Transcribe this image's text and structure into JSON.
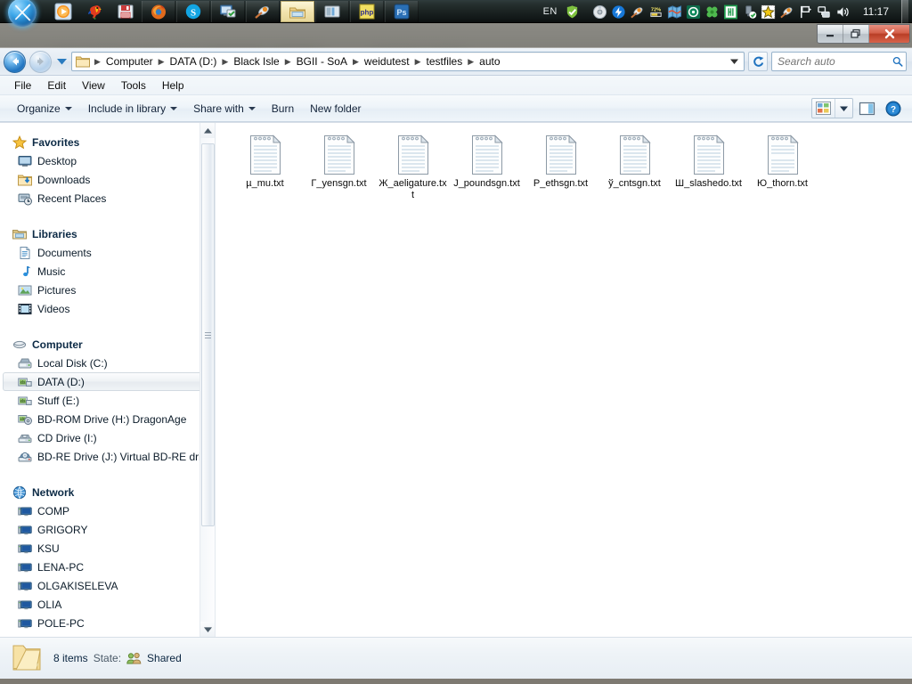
{
  "taskbar": {
    "start_button": "Start",
    "pinned_items": [
      {
        "name": "media-player-icon",
        "label": "Media Player"
      },
      {
        "name": "parrot-icon",
        "label": "Parrot"
      },
      {
        "name": "floppy-save-icon",
        "label": "Save"
      },
      {
        "name": "firefox-icon",
        "label": "Firefox"
      },
      {
        "name": "skype-icon",
        "label": "Skype"
      },
      {
        "name": "remote-desktop-icon",
        "label": "Remote Desktop"
      },
      {
        "name": "comet-icon",
        "label": "Comet"
      },
      {
        "name": "explorer-icon",
        "label": "Windows Explorer"
      },
      {
        "name": "presentation-icon",
        "label": "Presentation"
      },
      {
        "name": "php-icon",
        "label": "PHP"
      },
      {
        "name": "photoshop-icon",
        "label": "Ps"
      }
    ],
    "language": "EN",
    "tray_icons": [
      {
        "name": "shield-check-icon",
        "label": "Security"
      },
      {
        "name": "disc-icon",
        "label": "Disc"
      },
      {
        "name": "flash-icon",
        "label": "Flash"
      },
      {
        "name": "comet-tray-icon",
        "label": "Comet"
      },
      {
        "name": "battery-icon",
        "label": "72%"
      },
      {
        "name": "map-icon",
        "label": "Map"
      },
      {
        "name": "green-circle-icon",
        "label": "Opera"
      },
      {
        "name": "clover-icon",
        "label": "Clover"
      },
      {
        "name": "notepad-green-icon",
        "label": "Notepad"
      },
      {
        "name": "usb-check-icon",
        "label": "Safely Remove Hardware"
      },
      {
        "name": "yellow-burst-icon",
        "label": "Update"
      },
      {
        "name": "comet2-icon",
        "label": "Comet"
      },
      {
        "name": "flag-icon",
        "label": "Action Center"
      },
      {
        "name": "network-icon",
        "label": "Network"
      },
      {
        "name": "volume-icon",
        "label": "Volume"
      }
    ],
    "battery_label": "72%",
    "clock": "11:17"
  },
  "window": {
    "controls": {
      "minimize_label": "Minimize",
      "maximize_label": "Restore Down",
      "close_label": "Close"
    }
  },
  "navbar": {
    "back_label": "Back",
    "forward_label": "Forward",
    "recent_label": "Recent pages",
    "breadcrumbs": [
      "Computer",
      "DATA (D:)",
      "Black Isle",
      "BGII - SoA",
      "weidutest",
      "testfiles",
      "auto"
    ],
    "address_dropdown_label": "Previous locations",
    "refresh_label": "Refresh",
    "search": {
      "placeholder": "Search auto",
      "value": "",
      "icon": "search-icon"
    }
  },
  "menubar": {
    "items": [
      "File",
      "Edit",
      "View",
      "Tools",
      "Help"
    ]
  },
  "toolbar": {
    "commands": [
      {
        "label": "Organize",
        "has_caret": true
      },
      {
        "label": "Include in library",
        "has_caret": true
      },
      {
        "label": "Share with",
        "has_caret": true
      },
      {
        "label": "Burn",
        "has_caret": false
      },
      {
        "label": "New folder",
        "has_caret": false
      }
    ],
    "view_button_label": "Change your view",
    "view_dropdown_label": "More options",
    "preview_pane_label": "Show the preview pane",
    "help_label": "Get help"
  },
  "navpane": {
    "groups": [
      {
        "header": {
          "label": "Favorites",
          "icon": "star-icon"
        },
        "items": [
          {
            "label": "Desktop",
            "icon": "desktop-icon"
          },
          {
            "label": "Downloads",
            "icon": "downloads-icon"
          },
          {
            "label": "Recent Places",
            "icon": "recent-places-icon"
          }
        ]
      },
      {
        "header": {
          "label": "Libraries",
          "icon": "libraries-icon"
        },
        "items": [
          {
            "label": "Documents",
            "icon": "documents-icon"
          },
          {
            "label": "Music",
            "icon": "music-icon"
          },
          {
            "label": "Pictures",
            "icon": "pictures-icon"
          },
          {
            "label": "Videos",
            "icon": "videos-icon"
          }
        ]
      },
      {
        "header": {
          "label": "Computer",
          "icon": "computer-icon"
        },
        "items": [
          {
            "label": "Local Disk (C:)",
            "icon": "hdd-icon",
            "selected": false
          },
          {
            "label": "DATA (D:)",
            "icon": "drive-icon",
            "selected": true
          },
          {
            "label": "Stuff (E:)",
            "icon": "drive-icon",
            "selected": false
          },
          {
            "label": "BD-ROM Drive (H:) DragonAge",
            "icon": "bdrom-icon",
            "selected": false
          },
          {
            "label": "CD Drive (I:)",
            "icon": "cd-icon",
            "selected": false
          },
          {
            "label": "BD-RE Drive (J:) Virtual BD-RE drive",
            "icon": "bdre-icon",
            "selected": false
          }
        ]
      },
      {
        "header": {
          "label": "Network",
          "icon": "network-globe-icon"
        },
        "items": [
          {
            "label": "COMP",
            "icon": "computer-node-icon"
          },
          {
            "label": "GRIGORY",
            "icon": "computer-node-icon"
          },
          {
            "label": "KSU",
            "icon": "computer-node-icon"
          },
          {
            "label": "LENA-PC",
            "icon": "computer-node-icon"
          },
          {
            "label": "OLGAKISELEVA",
            "icon": "computer-node-icon"
          },
          {
            "label": "OLIA",
            "icon": "computer-node-icon"
          },
          {
            "label": "POLE-PC",
            "icon": "computer-node-icon"
          }
        ]
      }
    ],
    "scroll_up_label": "Scroll up",
    "scroll_down_label": "Scroll down"
  },
  "files": [
    {
      "name": "µ_mu.txt",
      "icon": "text-file-icon"
    },
    {
      "name": "Г_yensgn.txt",
      "icon": "text-file-icon"
    },
    {
      "name": "Ж_aeligature.txt",
      "icon": "text-file-icon"
    },
    {
      "name": "J_poundsgn.txt",
      "icon": "text-file-icon"
    },
    {
      "name": "Р_ethsgn.txt",
      "icon": "text-file-icon"
    },
    {
      "name": "ў_cntsgn.txt",
      "icon": "text-file-icon"
    },
    {
      "name": "Ш_slashedo.txt",
      "icon": "text-file-icon"
    },
    {
      "name": "Ю_thorn.txt",
      "icon": "text-file-icon"
    }
  ],
  "statusbar": {
    "folder_icon": "folder-icon",
    "item_count": "8 items",
    "state_label": "State:",
    "state_icon": "shared-users-icon",
    "state_value": "Shared"
  },
  "colors": {
    "accent_blue": "#1f72bf",
    "close_red": "#c44a30",
    "selection_gray": "#e6eaef",
    "taskbar_dark": "#1b2322",
    "window_bg": "#ffffff"
  }
}
